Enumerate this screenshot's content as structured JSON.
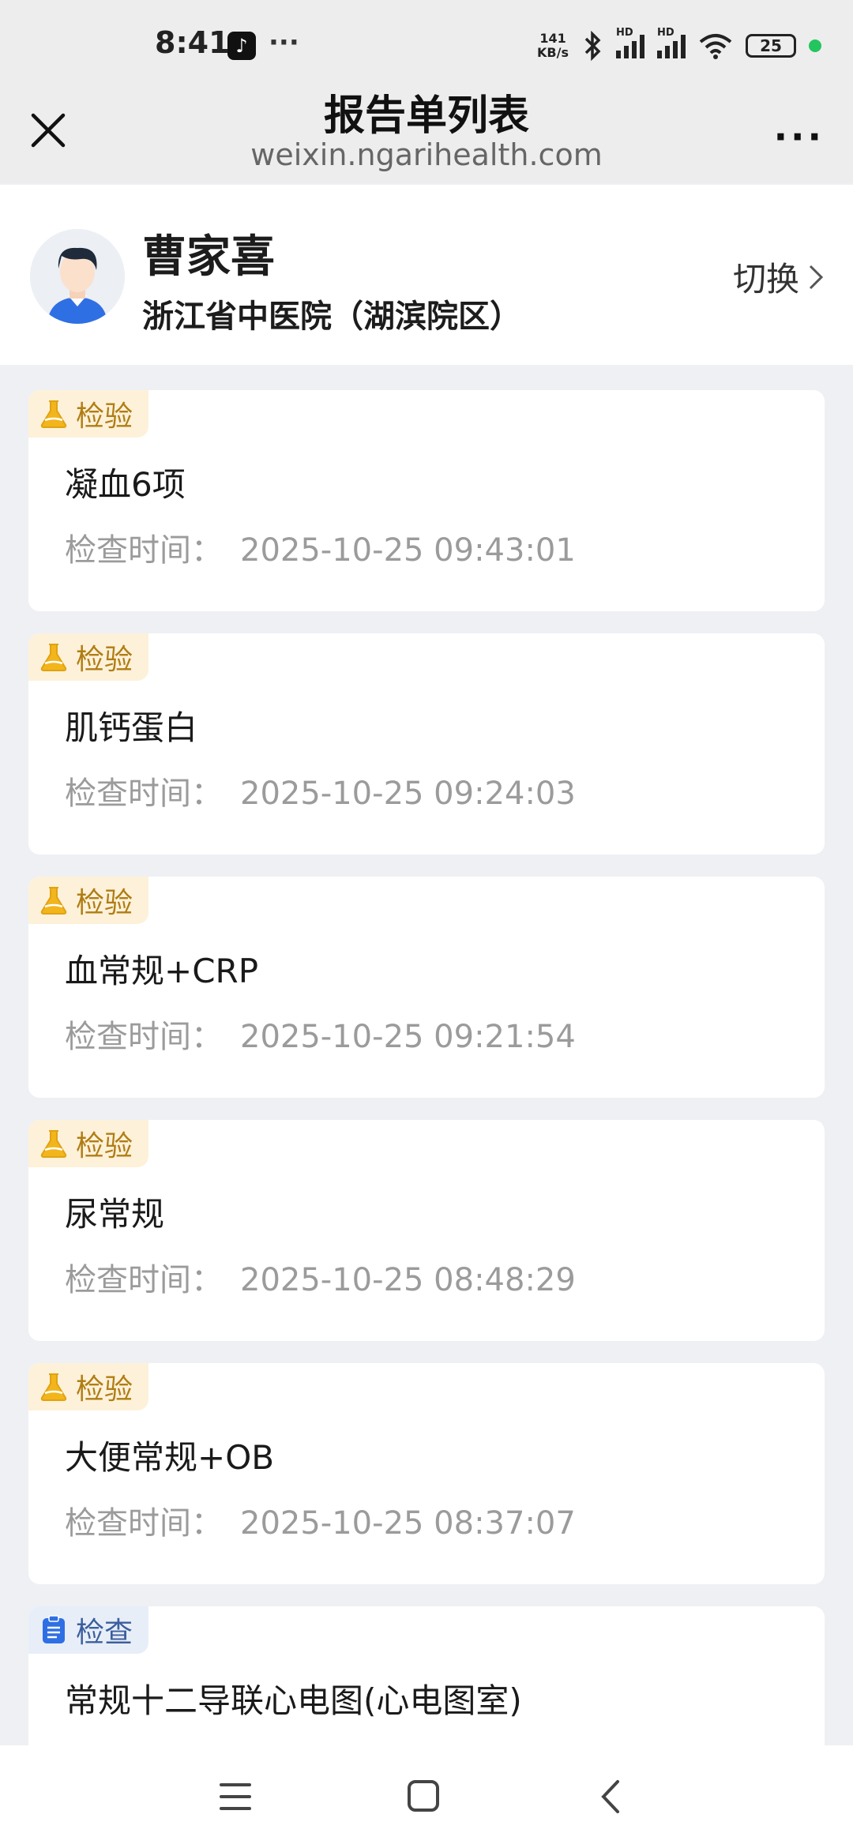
{
  "status": {
    "time": "8:41",
    "tiktok_glyph": "♪",
    "more_dots": "···",
    "net_speed": "141\nKB/s",
    "sim1_label": "HD",
    "sim2_label": "HD",
    "battery": "25",
    "icons": [
      "tiktok-icon",
      "bluetooth-icon",
      "signal-icon",
      "wifi-icon",
      "battery-icon"
    ]
  },
  "titlebar": {
    "title": "报告单列表",
    "domain": "weixin.ngarihealth.com",
    "more": "···"
  },
  "patient": {
    "name": "曹家喜",
    "hospital": "浙江省中医院（湖滨院区）",
    "switch_label": "切换"
  },
  "reports": [
    {
      "type": "检验",
      "kind": "lab",
      "name": "凝血6项",
      "time_label": "检查时间：",
      "time": "2025-10-25 09:43:01"
    },
    {
      "type": "检验",
      "kind": "lab",
      "name": "肌钙蛋白",
      "time_label": "检查时间：",
      "time": "2025-10-25 09:24:03"
    },
    {
      "type": "检验",
      "kind": "lab",
      "name": "血常规+CRP",
      "time_label": "检查时间：",
      "time": "2025-10-25 09:21:54"
    },
    {
      "type": "检验",
      "kind": "lab",
      "name": "尿常规",
      "time_label": "检查时间：",
      "time": "2025-10-25 08:48:29"
    },
    {
      "type": "检验",
      "kind": "lab",
      "name": "大便常规+OB",
      "time_label": "检查时间：",
      "time": "2025-10-25 08:37:07"
    },
    {
      "type": "检查",
      "kind": "exam",
      "name": "常规十二导联心电图(心电图室)",
      "time_label": "",
      "time": ""
    }
  ],
  "colors": {
    "lab_tag_bg": "#fdf1d9",
    "lab_tag_text": "#b07d14",
    "exam_tag_bg": "#e8eef8",
    "exam_tag_text": "#3b5f9e",
    "page_bg": "#eef0f4"
  }
}
